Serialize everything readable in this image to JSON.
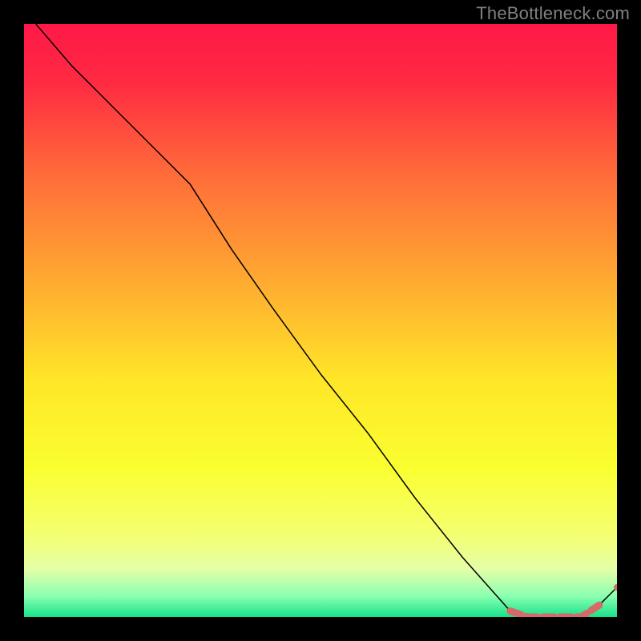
{
  "watermark": "TheBottleneck.com",
  "chart_data": {
    "type": "line",
    "xlim": [
      0,
      100
    ],
    "ylim": [
      0,
      100
    ],
    "grid": false,
    "legend": false,
    "title": "",
    "xlabel": "",
    "ylabel": "",
    "background_gradient": [
      {
        "stop": 0.0,
        "color": "#ff1848"
      },
      {
        "stop": 0.1,
        "color": "#ff2b42"
      },
      {
        "stop": 0.25,
        "color": "#ff6a3a"
      },
      {
        "stop": 0.45,
        "color": "#ffb030"
      },
      {
        "stop": 0.6,
        "color": "#ffe628"
      },
      {
        "stop": 0.75,
        "color": "#faff30"
      },
      {
        "stop": 0.86,
        "color": "#f4ff70"
      },
      {
        "stop": 0.92,
        "color": "#e4ffa8"
      },
      {
        "stop": 0.965,
        "color": "#8affb0"
      },
      {
        "stop": 1.0,
        "color": "#18e38a"
      }
    ],
    "series": [
      {
        "name": "line",
        "color": "#000000",
        "width": 1.5,
        "x": [
          2,
          8,
          15,
          22,
          28,
          35,
          42,
          50,
          58,
          66,
          74,
          82,
          85,
          88,
          91,
          94,
          97,
          100
        ],
        "y": [
          100,
          93,
          86,
          79,
          73,
          62,
          52,
          41,
          31,
          20,
          10,
          1,
          0,
          0,
          0,
          0,
          2,
          5
        ]
      },
      {
        "name": "plateau-band",
        "color": "#d66a6a",
        "thick": true,
        "x": [
          82,
          85,
          88,
          91,
          94,
          97
        ],
        "y": [
          1,
          0,
          0,
          0,
          0,
          2
        ]
      }
    ],
    "points": [
      {
        "name": "end-dot",
        "x": 100,
        "y": 5,
        "r": 4,
        "color": "#d66a6a"
      }
    ]
  }
}
